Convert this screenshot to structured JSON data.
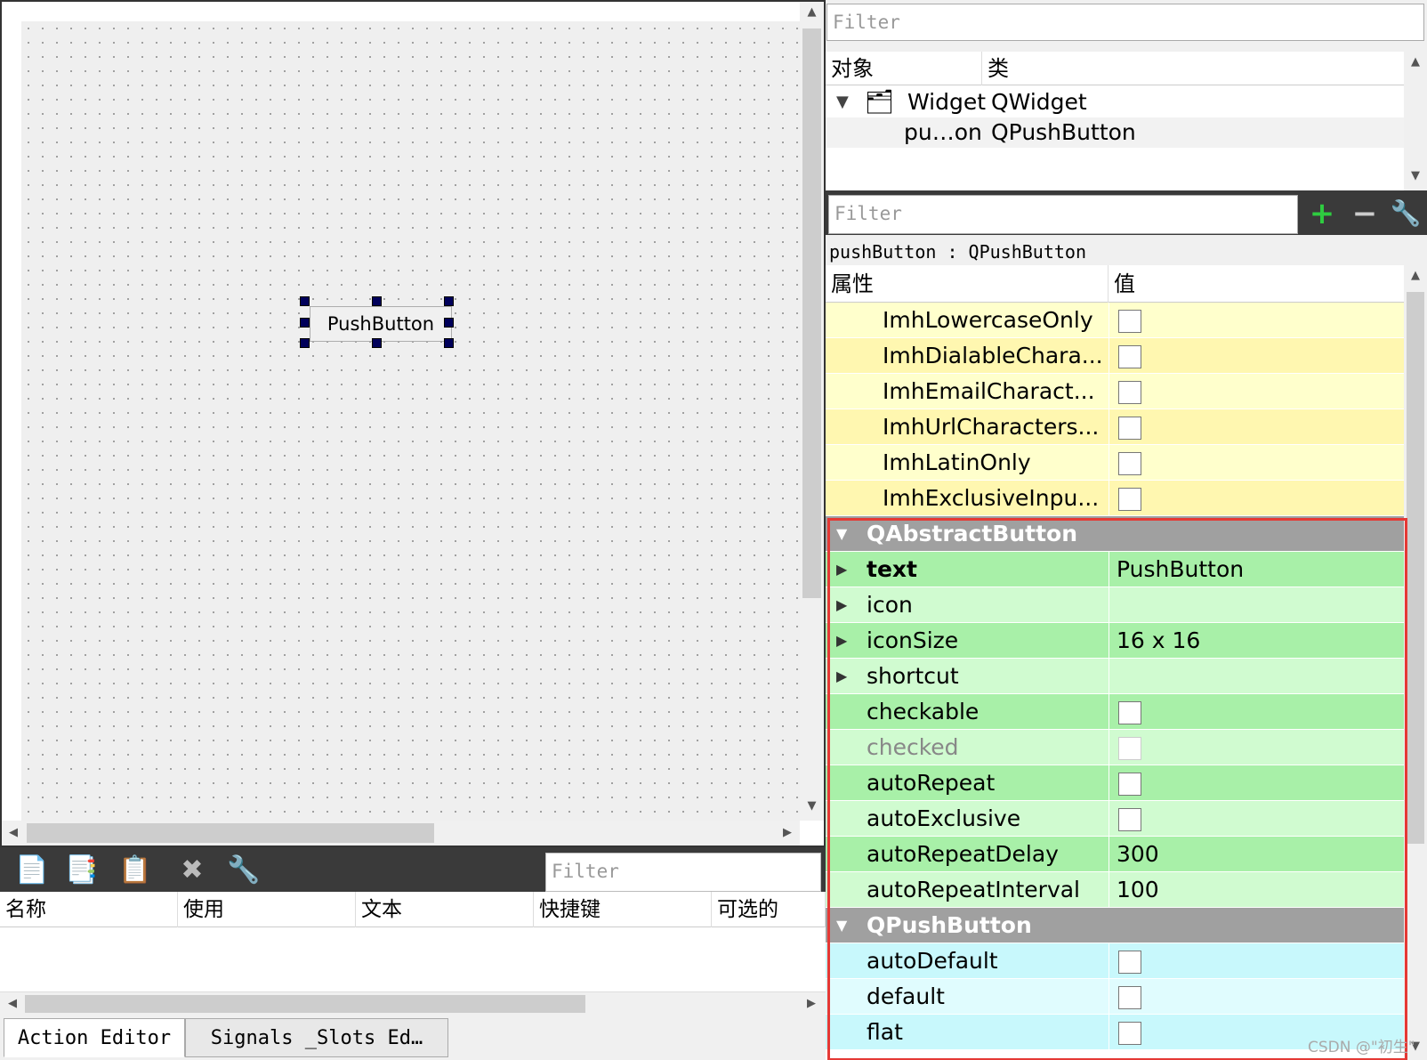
{
  "designer": {
    "button_text": "PushButton"
  },
  "action_editor": {
    "filter_placeholder": "Filter",
    "columns": [
      "名称",
      "使用",
      "文本",
      "快捷键",
      "可选的"
    ],
    "tabs": [
      "Action Editor",
      "Signals _Slots Ed…"
    ]
  },
  "object_inspector": {
    "filter_placeholder": "Filter",
    "columns": [
      "对象",
      "类"
    ],
    "rows": [
      {
        "name": "Widget",
        "class": "QWidget"
      },
      {
        "name": "pu…on",
        "class": "QPushButton"
      }
    ]
  },
  "property_editor": {
    "filter_placeholder": "Filter",
    "subtitle": "pushButton : QPushButton",
    "columns": [
      "属性",
      "值"
    ],
    "rows": [
      {
        "name": "ImhLowercaseOnly",
        "checkbox": true
      },
      {
        "name": "ImhDialableChara...",
        "checkbox": true
      },
      {
        "name": "ImhEmailCharact...",
        "checkbox": true
      },
      {
        "name": "ImhUrlCharacters...",
        "checkbox": true
      },
      {
        "name": "ImhLatinOnly",
        "checkbox": true
      },
      {
        "name": "ImhExclusiveInpu...",
        "checkbox": true
      },
      {
        "group": "QAbstractButton"
      },
      {
        "name": "text",
        "value": "PushButton",
        "expand": true,
        "bold": true
      },
      {
        "name": "icon",
        "value": "",
        "expand": true
      },
      {
        "name": "iconSize",
        "value": "16 x 16",
        "expand": true
      },
      {
        "name": "shortcut",
        "value": "",
        "expand": true
      },
      {
        "name": "checkable",
        "checkbox": true
      },
      {
        "name": "checked",
        "checkbox": true,
        "disabled": true
      },
      {
        "name": "autoRepeat",
        "checkbox": true
      },
      {
        "name": "autoExclusive",
        "checkbox": true
      },
      {
        "name": "autoRepeatDelay",
        "value": "300"
      },
      {
        "name": "autoRepeatInterval",
        "value": "100"
      },
      {
        "group": "QPushButton"
      },
      {
        "name": "autoDefault",
        "checkbox": true
      },
      {
        "name": "default",
        "checkbox": true
      },
      {
        "name": "flat",
        "checkbox": true
      }
    ]
  },
  "watermark": "CSDN @\"初生\"",
  "colors": {
    "highlight_frame": "#e53935",
    "inherited_rows": "#ffffcc",
    "abstract_button_rows": "#a8f0a8",
    "push_button_rows": "#c8f8fc",
    "group_header": "#a0a0a0"
  }
}
